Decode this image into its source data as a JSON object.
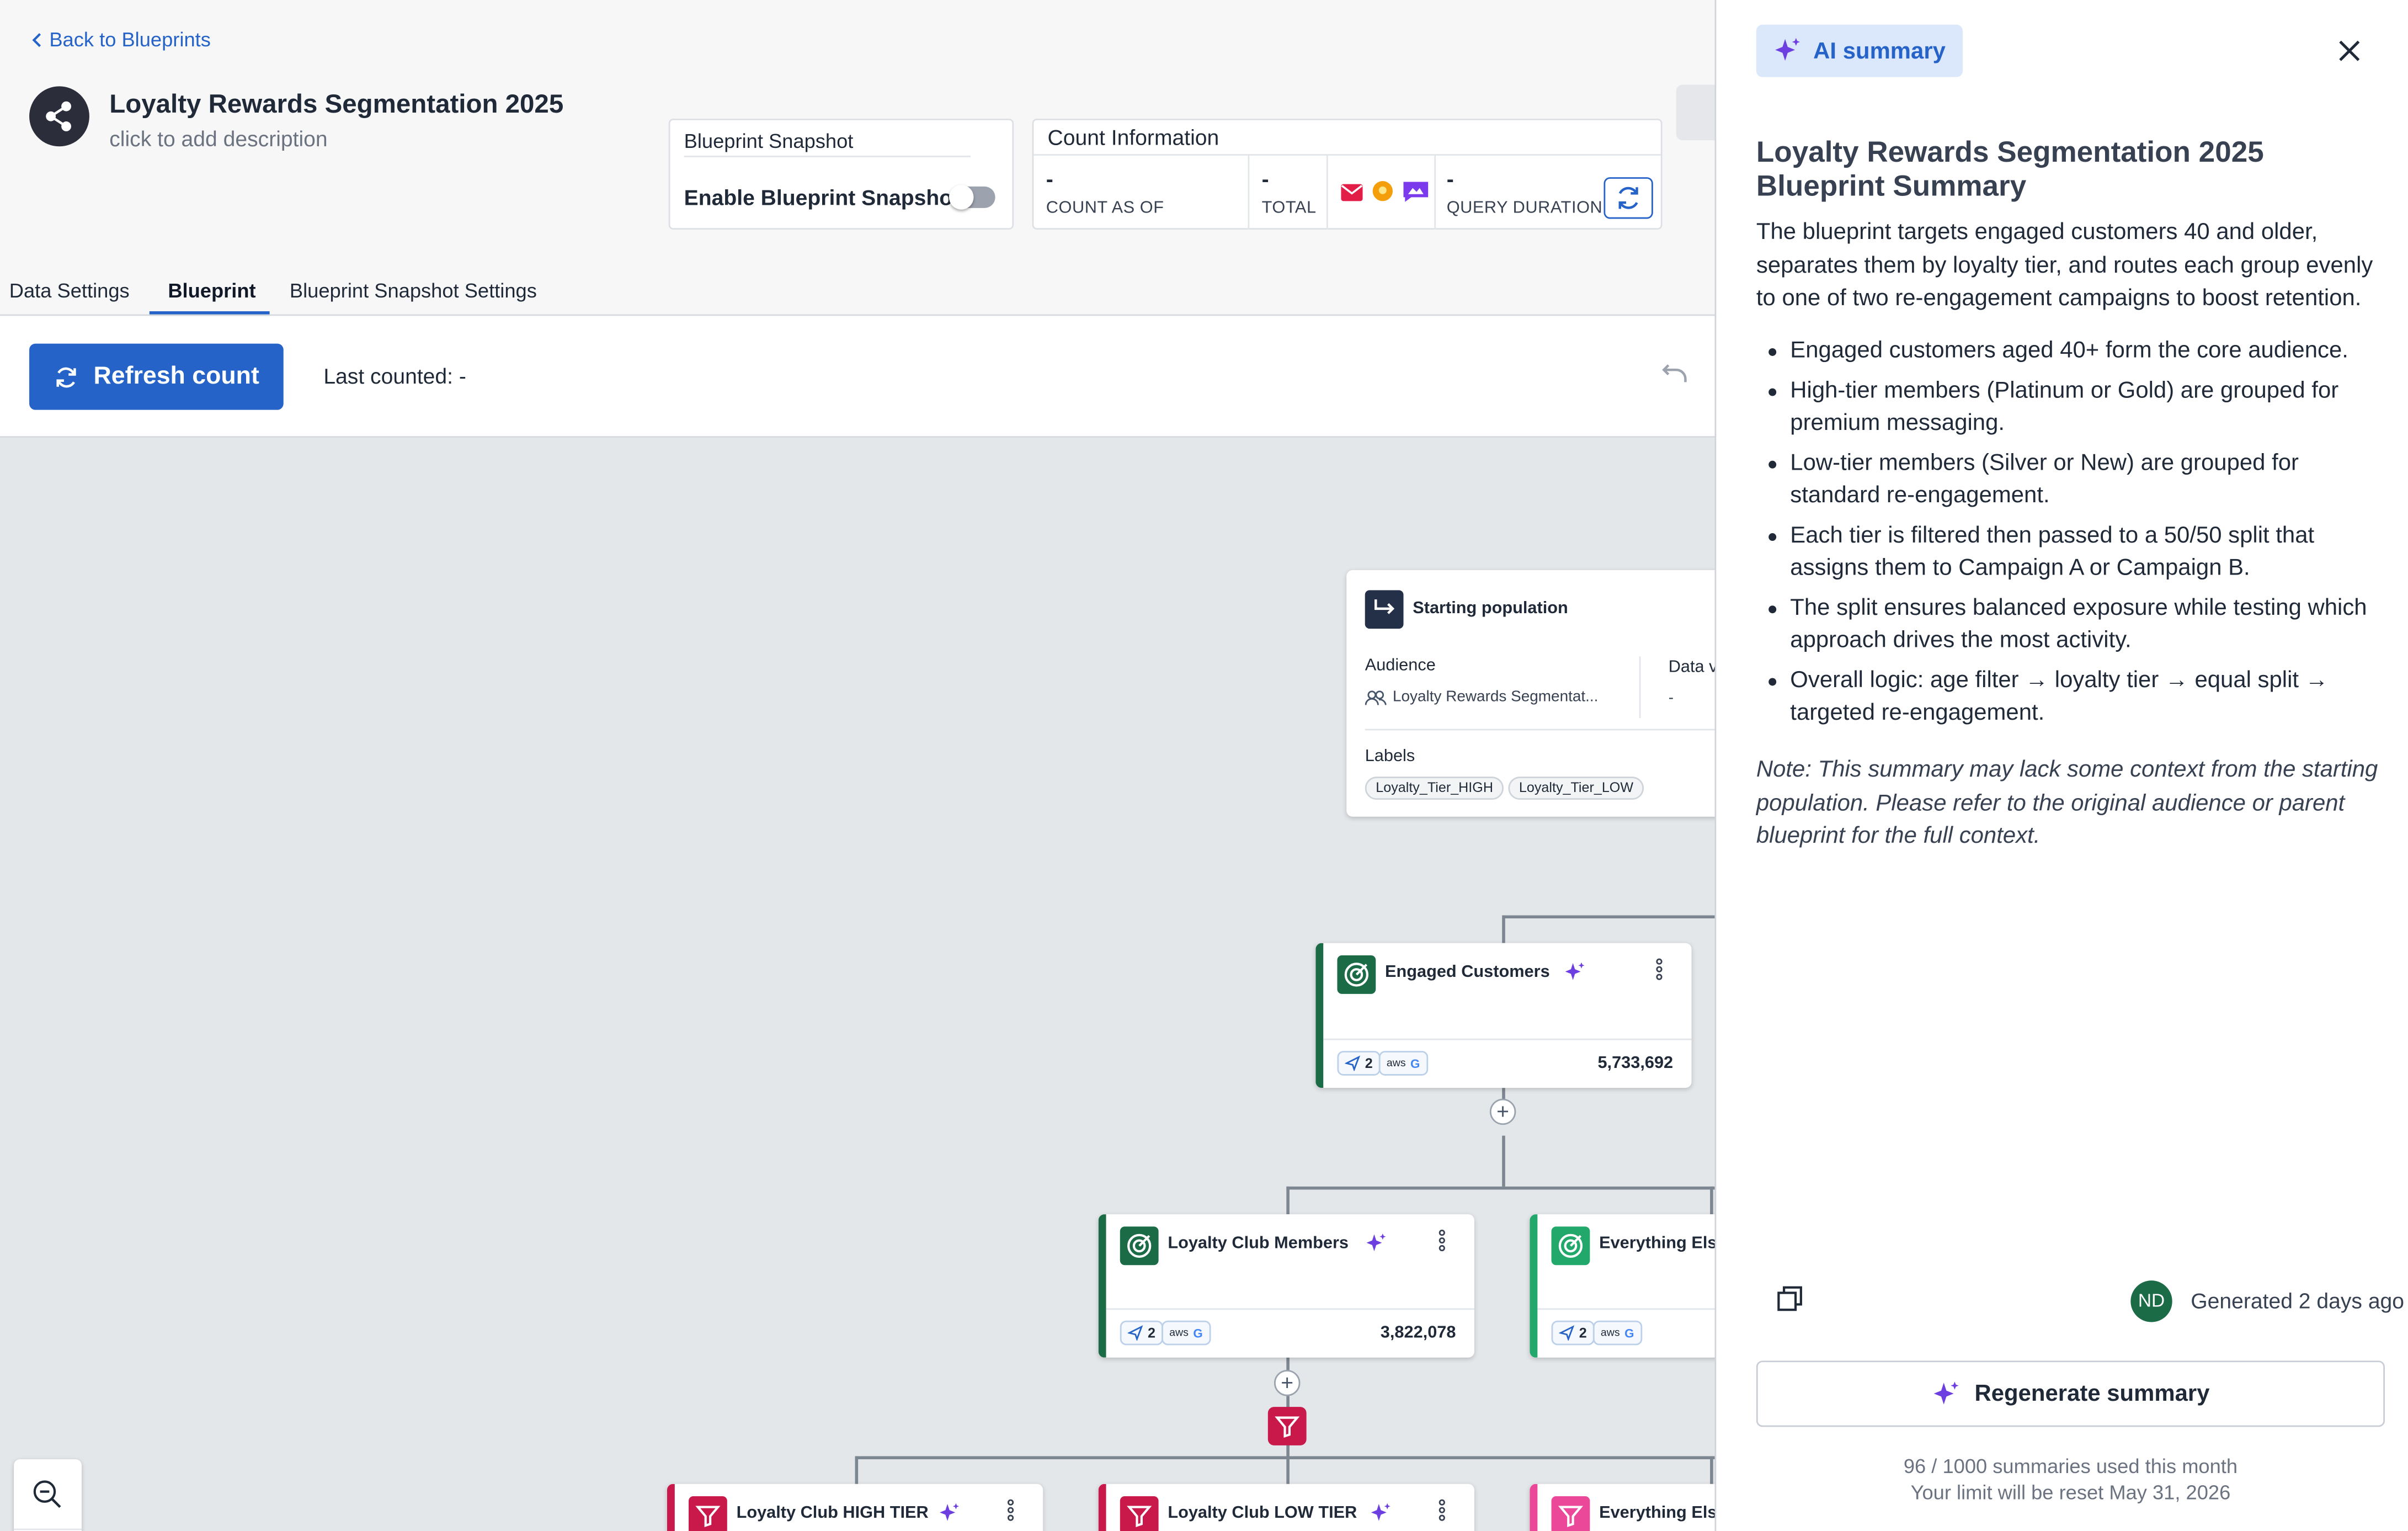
{
  "header": {
    "back_label": "Back to Blueprints",
    "title": "Loyalty Rewards Segmentation 2025",
    "description_placeholder": "click to add description"
  },
  "snapshot": {
    "heading": "Blueprint Snapshot",
    "toggle_label": "Enable Blueprint Snapshot",
    "enabled": false
  },
  "count_info": {
    "heading": "Count Information",
    "count_as_of_value": "-",
    "count_as_of_label": "COUNT AS OF",
    "total_value": "-",
    "total_label": "TOTAL",
    "query_duration_value": "-",
    "query_duration_label": "QUERY DURATION"
  },
  "tabs": [
    {
      "label": "Data Settings",
      "active": false
    },
    {
      "label": "Blueprint",
      "active": true
    },
    {
      "label": "Blueprint Snapshot Settings",
      "active": false
    }
  ],
  "toolbar": {
    "refresh_label": "Refresh count",
    "last_counted": "Last counted: -"
  },
  "start_node": {
    "title": "Starting population",
    "audience_label": "Audience",
    "audience_value": "Loyalty Rewards Segmentat...",
    "data_label": "Data v",
    "data_value": "-",
    "labels_heading": "Labels",
    "labels": [
      "Loyalty_Tier_HIGH",
      "Loyalty_Tier_LOW"
    ]
  },
  "nodes": {
    "engaged": {
      "title": "Engaged Customers",
      "channels": "2",
      "count": "5,733,692"
    },
    "loyalty_members": {
      "title": "Loyalty Club Members",
      "channels": "2",
      "count": "3,822,078"
    },
    "everything_else_1": {
      "title": "Everything Els",
      "channels": "2"
    },
    "high_tier": {
      "title": "Loyalty Club HIGH TIER"
    },
    "low_tier": {
      "title": "Loyalty Club LOW TIER"
    },
    "everything_else_2": {
      "title": "Everything Els"
    }
  },
  "ai_panel": {
    "badge": "AI summary",
    "title": "Loyalty Rewards Segmentation 2025 Blueprint Summary",
    "intro": "The blueprint targets engaged customers 40 and older, separates them by loyalty tier, and routes each group evenly to one of two re-engagement campaigns to boost retention.",
    "bullets": [
      "Engaged customers aged 40+ form the core audience.",
      "High-tier members (Platinum or Gold) are grouped for premium messaging.",
      "Low-tier members (Silver or New) are grouped for standard re-engagement.",
      "Each tier is filtered then passed to a 50/50 split that assigns them to Campaign A or Campaign B.",
      "The split ensures balanced exposure while testing which approach drives the most activity.",
      "Overall logic: age filter → loyalty tier → equal split → targeted re-engagement."
    ],
    "note": "Note: This summary may lack some context from the starting population. Please refer to the original audience or parent blueprint for the full context.",
    "avatar_initials": "ND",
    "generated": "Generated 2 days ago",
    "regenerate_label": "Regenerate summary",
    "usage": "96 / 1000 summaries used this month",
    "reset": "Your limit will be reset May 31, 2026"
  },
  "colors": {
    "primary": "#2563c9",
    "dark_green": "#1b6b47",
    "light_green": "#22a86a",
    "filter_red": "#c9184a",
    "ai_purple": "#6d3fe0"
  }
}
